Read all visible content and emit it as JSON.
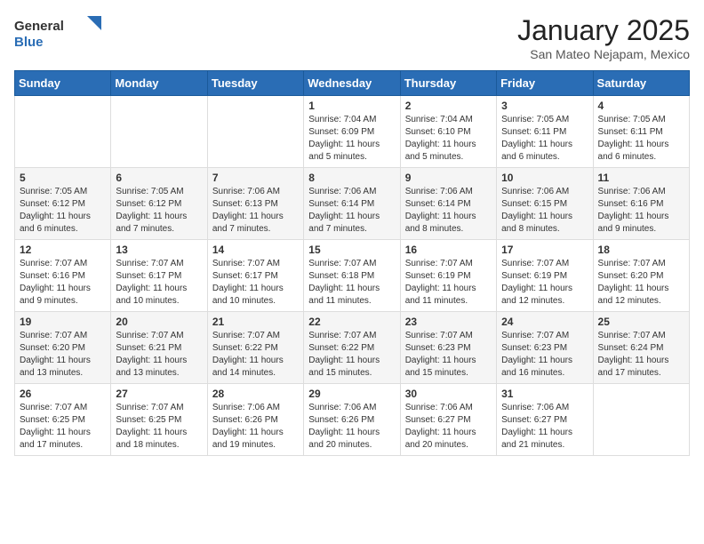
{
  "header": {
    "logo": {
      "general": "General",
      "blue": "Blue"
    },
    "title": "January 2025",
    "subtitle": "San Mateo Nejapam, Mexico"
  },
  "days_of_week": [
    "Sunday",
    "Monday",
    "Tuesday",
    "Wednesday",
    "Thursday",
    "Friday",
    "Saturday"
  ],
  "weeks": [
    [
      {
        "day": "",
        "info": ""
      },
      {
        "day": "",
        "info": ""
      },
      {
        "day": "",
        "info": ""
      },
      {
        "day": "1",
        "info": "Sunrise: 7:04 AM\nSunset: 6:09 PM\nDaylight: 11 hours and 5 minutes."
      },
      {
        "day": "2",
        "info": "Sunrise: 7:04 AM\nSunset: 6:10 PM\nDaylight: 11 hours and 5 minutes."
      },
      {
        "day": "3",
        "info": "Sunrise: 7:05 AM\nSunset: 6:11 PM\nDaylight: 11 hours and 6 minutes."
      },
      {
        "day": "4",
        "info": "Sunrise: 7:05 AM\nSunset: 6:11 PM\nDaylight: 11 hours and 6 minutes."
      }
    ],
    [
      {
        "day": "5",
        "info": "Sunrise: 7:05 AM\nSunset: 6:12 PM\nDaylight: 11 hours and 6 minutes."
      },
      {
        "day": "6",
        "info": "Sunrise: 7:05 AM\nSunset: 6:12 PM\nDaylight: 11 hours and 7 minutes."
      },
      {
        "day": "7",
        "info": "Sunrise: 7:06 AM\nSunset: 6:13 PM\nDaylight: 11 hours and 7 minutes."
      },
      {
        "day": "8",
        "info": "Sunrise: 7:06 AM\nSunset: 6:14 PM\nDaylight: 11 hours and 7 minutes."
      },
      {
        "day": "9",
        "info": "Sunrise: 7:06 AM\nSunset: 6:14 PM\nDaylight: 11 hours and 8 minutes."
      },
      {
        "day": "10",
        "info": "Sunrise: 7:06 AM\nSunset: 6:15 PM\nDaylight: 11 hours and 8 minutes."
      },
      {
        "day": "11",
        "info": "Sunrise: 7:06 AM\nSunset: 6:16 PM\nDaylight: 11 hours and 9 minutes."
      }
    ],
    [
      {
        "day": "12",
        "info": "Sunrise: 7:07 AM\nSunset: 6:16 PM\nDaylight: 11 hours and 9 minutes."
      },
      {
        "day": "13",
        "info": "Sunrise: 7:07 AM\nSunset: 6:17 PM\nDaylight: 11 hours and 10 minutes."
      },
      {
        "day": "14",
        "info": "Sunrise: 7:07 AM\nSunset: 6:17 PM\nDaylight: 11 hours and 10 minutes."
      },
      {
        "day": "15",
        "info": "Sunrise: 7:07 AM\nSunset: 6:18 PM\nDaylight: 11 hours and 11 minutes."
      },
      {
        "day": "16",
        "info": "Sunrise: 7:07 AM\nSunset: 6:19 PM\nDaylight: 11 hours and 11 minutes."
      },
      {
        "day": "17",
        "info": "Sunrise: 7:07 AM\nSunset: 6:19 PM\nDaylight: 11 hours and 12 minutes."
      },
      {
        "day": "18",
        "info": "Sunrise: 7:07 AM\nSunset: 6:20 PM\nDaylight: 11 hours and 12 minutes."
      }
    ],
    [
      {
        "day": "19",
        "info": "Sunrise: 7:07 AM\nSunset: 6:20 PM\nDaylight: 11 hours and 13 minutes."
      },
      {
        "day": "20",
        "info": "Sunrise: 7:07 AM\nSunset: 6:21 PM\nDaylight: 11 hours and 13 minutes."
      },
      {
        "day": "21",
        "info": "Sunrise: 7:07 AM\nSunset: 6:22 PM\nDaylight: 11 hours and 14 minutes."
      },
      {
        "day": "22",
        "info": "Sunrise: 7:07 AM\nSunset: 6:22 PM\nDaylight: 11 hours and 15 minutes."
      },
      {
        "day": "23",
        "info": "Sunrise: 7:07 AM\nSunset: 6:23 PM\nDaylight: 11 hours and 15 minutes."
      },
      {
        "day": "24",
        "info": "Sunrise: 7:07 AM\nSunset: 6:23 PM\nDaylight: 11 hours and 16 minutes."
      },
      {
        "day": "25",
        "info": "Sunrise: 7:07 AM\nSunset: 6:24 PM\nDaylight: 11 hours and 17 minutes."
      }
    ],
    [
      {
        "day": "26",
        "info": "Sunrise: 7:07 AM\nSunset: 6:25 PM\nDaylight: 11 hours and 17 minutes."
      },
      {
        "day": "27",
        "info": "Sunrise: 7:07 AM\nSunset: 6:25 PM\nDaylight: 11 hours and 18 minutes."
      },
      {
        "day": "28",
        "info": "Sunrise: 7:06 AM\nSunset: 6:26 PM\nDaylight: 11 hours and 19 minutes."
      },
      {
        "day": "29",
        "info": "Sunrise: 7:06 AM\nSunset: 6:26 PM\nDaylight: 11 hours and 20 minutes."
      },
      {
        "day": "30",
        "info": "Sunrise: 7:06 AM\nSunset: 6:27 PM\nDaylight: 11 hours and 20 minutes."
      },
      {
        "day": "31",
        "info": "Sunrise: 7:06 AM\nSunset: 6:27 PM\nDaylight: 11 hours and 21 minutes."
      },
      {
        "day": "",
        "info": ""
      }
    ]
  ]
}
